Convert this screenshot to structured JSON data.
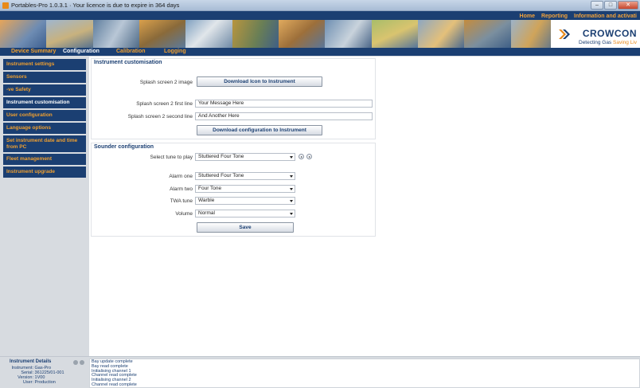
{
  "window": {
    "title": "Portables-Pro 1.0.3.1 · Your licence is due to expire in 364 days",
    "controls": [
      "–",
      "□",
      "✕"
    ]
  },
  "topnav": [
    "Home",
    "Reporting",
    "Information and activati"
  ],
  "logo": {
    "name": "CROWCON",
    "tagline_a": "Detecting Gas",
    "tagline_b": "Saving Liv"
  },
  "tabs": [
    "Device Summary",
    "Configuration",
    "Calibration",
    "Logging"
  ],
  "sidebar": {
    "items": [
      "Instrument settings",
      "Sensors",
      "-ve Safety",
      "Instrument customisation",
      "User configuration",
      "Language options",
      "Set instrument date and time from PC",
      "Fleet management",
      "Instrument upgrade"
    ]
  },
  "customisation": {
    "title": "Instrument customisation",
    "splash_image_label": "Splash screen 2 image",
    "download_icon_button": "Download Icon to Instrument",
    "first_line_label": "Splash screen 2 first line",
    "first_line_value": "Your Message Here",
    "second_line_label": "Splash screen 2 second line",
    "second_line_value": "And Another Here",
    "download_config_button": "Download configuration to Instrument"
  },
  "sounder": {
    "title": "Sounder configuration",
    "select_tune_label": "Select tune to play",
    "select_tune_value": "Stuttered Four Tone",
    "alarm_one_label": "Alarm one",
    "alarm_one_value": "Stuttered Four Tone",
    "alarm_two_label": "Alarm two",
    "alarm_two_value": "Four Tone",
    "twa_label": "TWA tune",
    "twa_value": "Warble",
    "volume_label": "Volume",
    "volume_value": "Normal",
    "save_button": "Save"
  },
  "details": {
    "title": "Instrument Details",
    "instrument_key": "Instrument:",
    "instrument_value": "Gas-Pro",
    "serial_key": "Serial:",
    "serial_value": "361225/01-001",
    "version_key": "Version:",
    "version_value": "1V00",
    "user_key": "User:",
    "user_value": "Production"
  },
  "log": [
    "Bay update complete",
    "Bay read complete",
    "Initialising channel 1",
    "Channel read complete",
    "Initialising channel 2",
    "Channel read complete"
  ],
  "colors": {
    "navy": "#1b3f72",
    "orange": "#f0a030",
    "background": "#d7dbe0"
  }
}
